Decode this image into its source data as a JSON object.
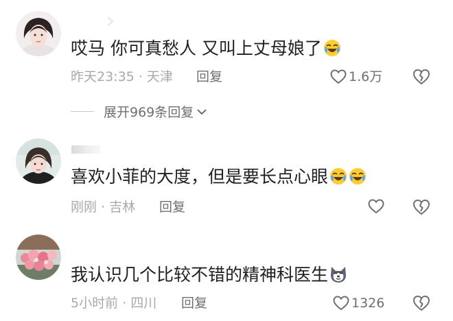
{
  "comments": [
    {
      "text": "哎马 你可真愁人 又叫上丈母娘了",
      "emojis": [
        "laugh-cry-emoji"
      ],
      "time": "昨天23:35",
      "location": "天津",
      "reply_label": "回复",
      "likes": "1.6万"
    },
    {
      "text": "喜欢小菲的大度，但是要长点心眼",
      "emojis": [
        "laugh-cry-emoji",
        "laugh-cry-emoji"
      ],
      "time": "刚刚",
      "location": "吉林",
      "reply_label": "回复",
      "likes": ""
    },
    {
      "text": "我认识几个比较不错的精神科医生",
      "emojis": [
        "husky-dog-emoji"
      ],
      "time": "5小时前",
      "location": "四川",
      "reply_label": "回复",
      "likes": "1326"
    }
  ],
  "expand_replies": "展开969条回复",
  "meta_separator": " · ",
  "colors": {
    "primary_text": "#1f1f1f",
    "meta_text": "#a9a9ad",
    "action_text": "#6f6f73"
  },
  "icons": {
    "like": "heart-outline-icon",
    "dislike": "broken-heart-icon",
    "expand": "chevron-down-icon"
  }
}
